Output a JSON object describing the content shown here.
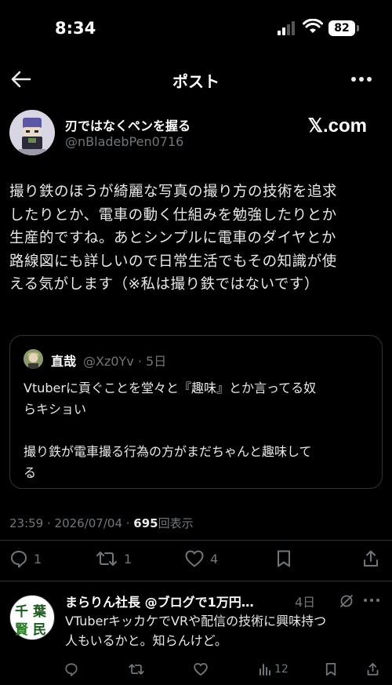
{
  "status_bar": {
    "time": "8:34",
    "battery": "82"
  },
  "header": {
    "title": "ポスト"
  },
  "post": {
    "author_name": "刃ではなくペンを握る",
    "author_handle": "@nBladebPen0716",
    "source": "𝕏.com",
    "lines": [
      "撮り鉄のほうが綺麗な写真の撮り方の技術を追求",
      "したりとか、電車の動く仕組みを勉強したりとか",
      "生産的ですね。あとシンプルに電車のダイヤとか",
      "路線図にも詳しいので日常生活でもその知識が使",
      "える気がします（※私は撮り鉄ではないです）"
    ],
    "timestamp": "23:59 · 2026/07/04 · ",
    "views_count": "695",
    "views_label": "回表示",
    "reply_count": "1",
    "repost_count": "1",
    "like_count": "4"
  },
  "quoted_post": {
    "author_name": "直哉",
    "meta": "@Xz0Yv · 5日",
    "paragraph1_line1": "Vtuberに貢ぐことを堂々と『趣味』とか言ってる奴",
    "paragraph1_line2": "らキショい",
    "paragraph2_line1": "撮り鉄が電車撮る行為の方がまだちゃんと趣味して",
    "paragraph2_line2": "る"
  },
  "reply": {
    "avatar_text": [
      "千",
      "葉",
      "賢",
      "民"
    ],
    "author_name": "まらりん社長 @ブログで1万円…",
    "date": "4日",
    "line1": "VTuberキッカケでVRや配信の技術に興味持つ",
    "line2": "人もいるかと。知らんけど。",
    "views_count": "12"
  },
  "colors": {
    "background": "#000000",
    "text": "#e7e9ea",
    "muted": "#71767b",
    "border": "#2f3336"
  }
}
